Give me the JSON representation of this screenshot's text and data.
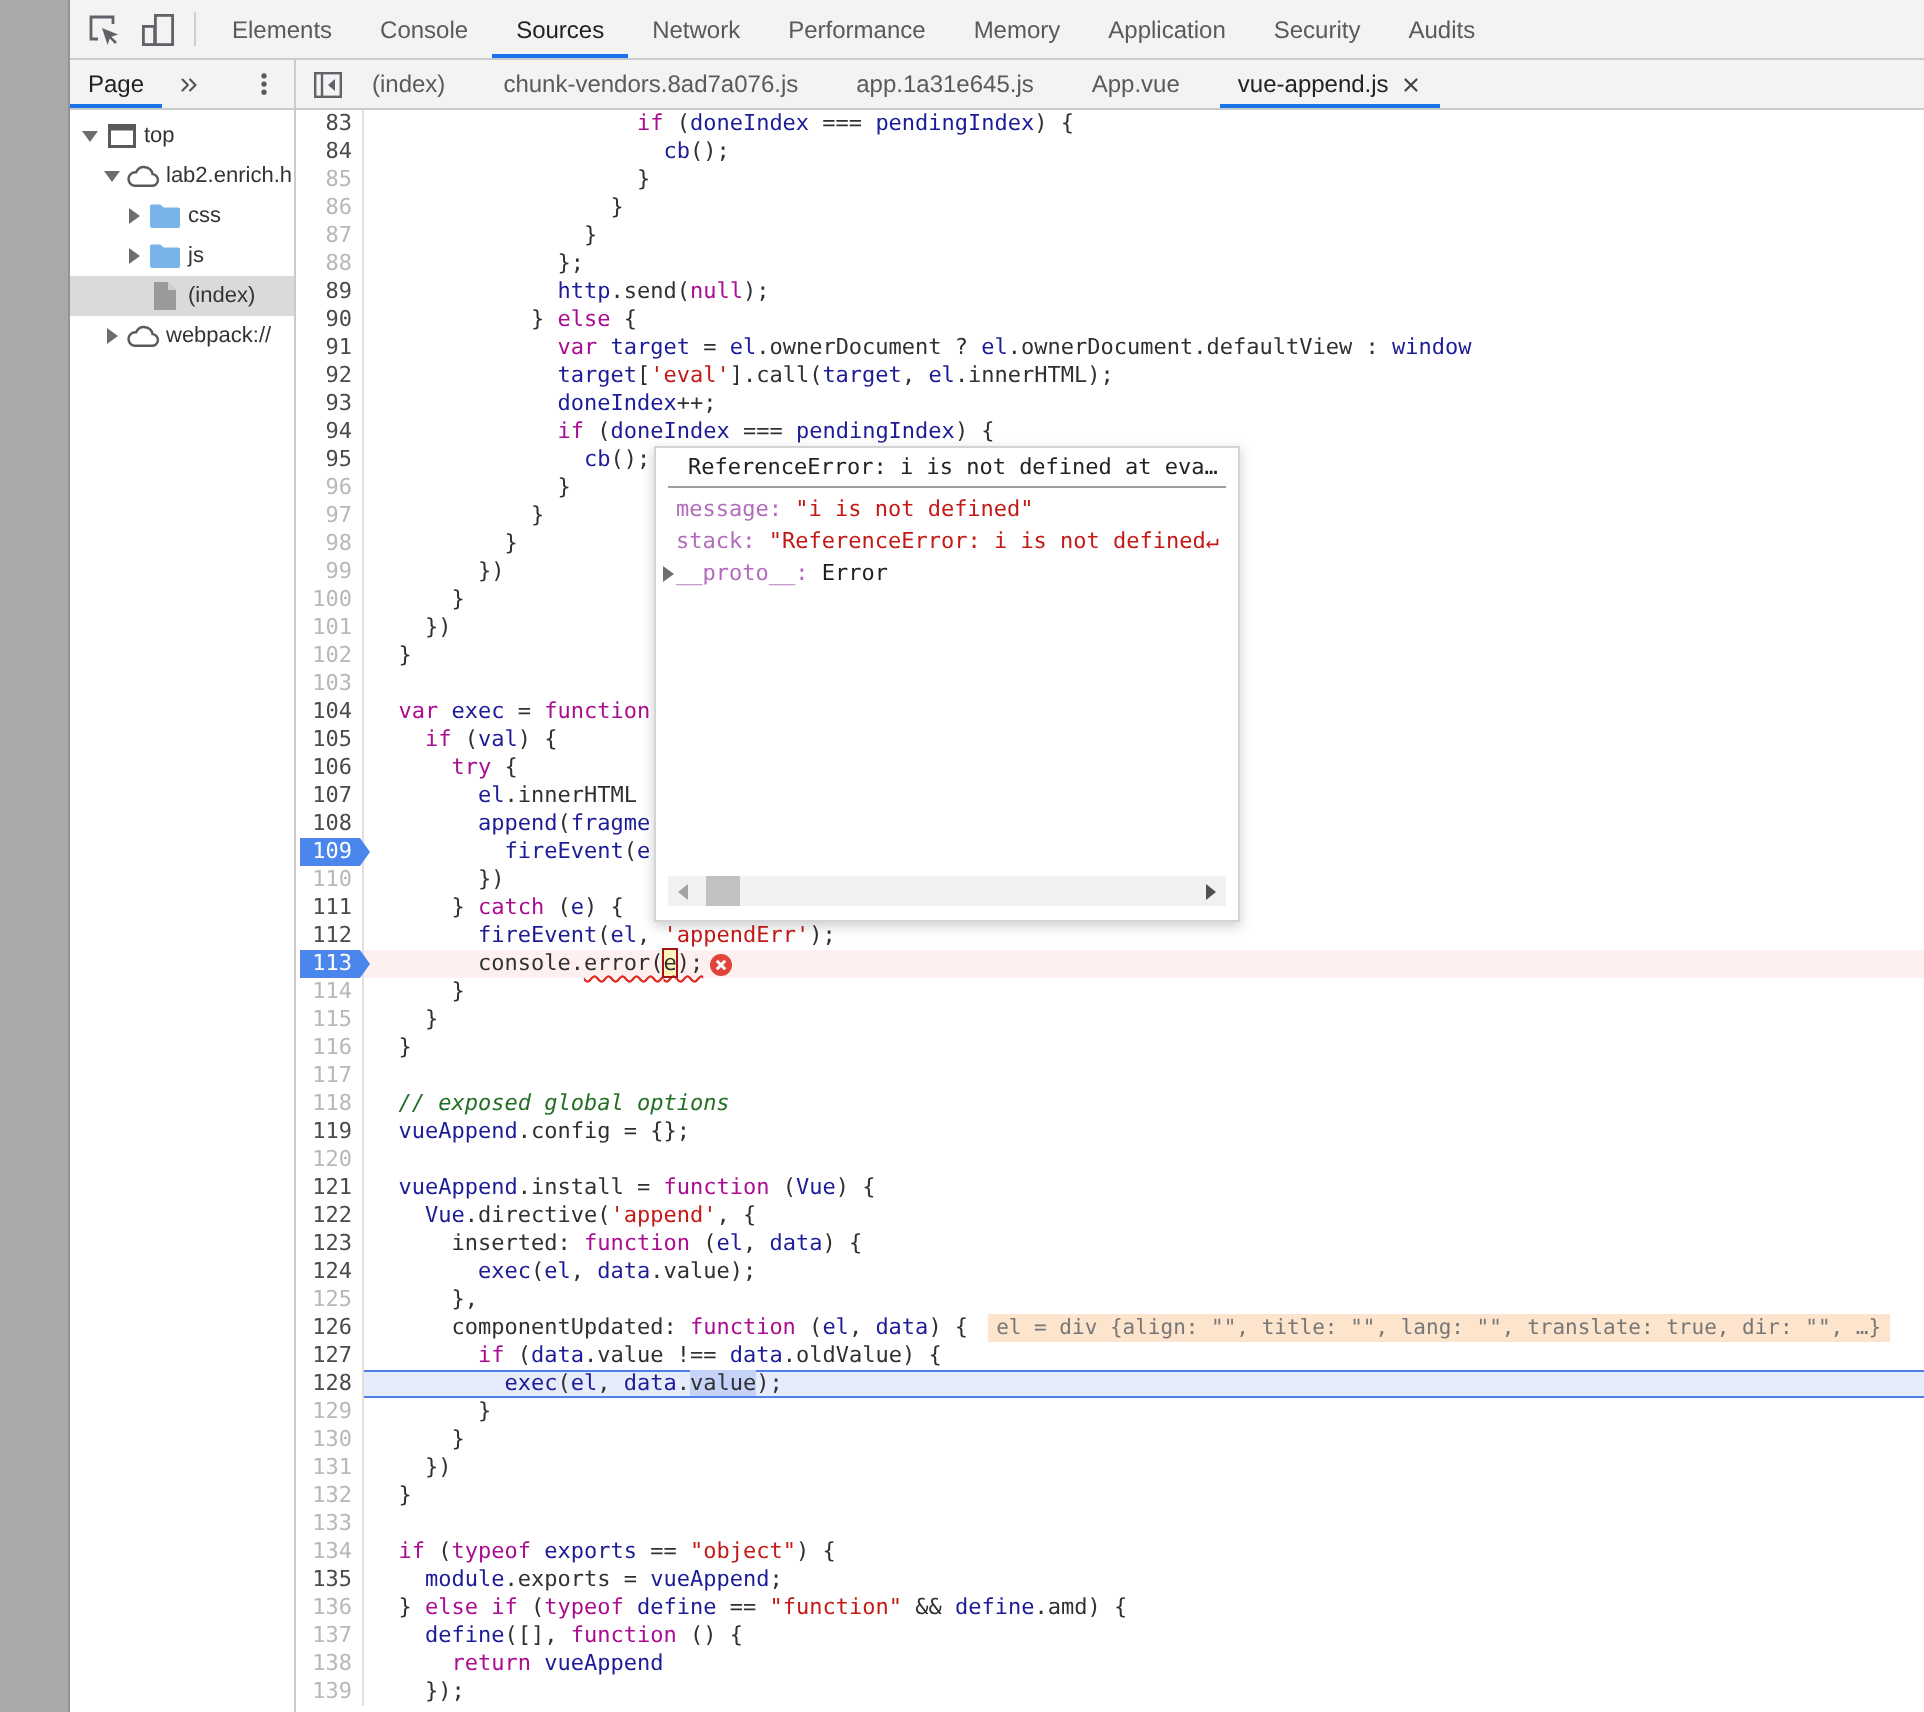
{
  "toolbar": {
    "tabs": [
      {
        "label": "Elements",
        "selected": false
      },
      {
        "label": "Console",
        "selected": false
      },
      {
        "label": "Sources",
        "selected": true
      },
      {
        "label": "Network",
        "selected": false
      },
      {
        "label": "Performance",
        "selected": false
      },
      {
        "label": "Memory",
        "selected": false
      },
      {
        "label": "Application",
        "selected": false
      },
      {
        "label": "Security",
        "selected": false
      },
      {
        "label": "Audits",
        "selected": false
      }
    ]
  },
  "navigator": {
    "tabs": [
      {
        "label": "Page",
        "selected": true
      }
    ],
    "tree": [
      {
        "label": "top",
        "kind": "frame",
        "expanded": true,
        "selected": false,
        "children": [
          {
            "label": "lab2.enrich.h",
            "kind": "domain",
            "expanded": true,
            "selected": false,
            "children": [
              {
                "label": "css",
                "kind": "folder",
                "expanded": false,
                "selected": false
              },
              {
                "label": "js",
                "kind": "folder",
                "expanded": false,
                "selected": false
              },
              {
                "label": "(index)",
                "kind": "file",
                "selected": true
              }
            ]
          },
          {
            "label": "webpack://",
            "kind": "domain",
            "expanded": false,
            "selected": false
          }
        ]
      }
    ]
  },
  "editor": {
    "tabs": [
      {
        "label": "(index)",
        "selected": false,
        "closable": false
      },
      {
        "label": "chunk-vendors.8ad7a076.js",
        "selected": false,
        "closable": false
      },
      {
        "label": "app.1a31e645.js",
        "selected": false,
        "closable": false
      },
      {
        "label": "App.vue",
        "selected": false,
        "closable": false
      },
      {
        "label": "vue-append.js",
        "selected": true,
        "closable": true
      }
    ],
    "lines": [
      {
        "number": "83",
        "executable": true,
        "breakpoint": false,
        "current": false,
        "error": false,
        "tokens": [
          {
            "kind": "keyword",
            "text": "                    if"
          },
          {
            "kind": "plain",
            "text": " ("
          },
          {
            "kind": "variable",
            "text": "doneIndex"
          },
          {
            "kind": "plain",
            "text": " === "
          },
          {
            "kind": "variable",
            "text": "pendingIndex"
          },
          {
            "kind": "plain",
            "text": ") {"
          }
        ]
      },
      {
        "number": "84",
        "executable": true,
        "breakpoint": false,
        "current": false,
        "error": false,
        "tokens": [
          {
            "kind": "variable",
            "text": "                      cb"
          },
          {
            "kind": "plain",
            "text": "();"
          }
        ]
      },
      {
        "number": "85",
        "executable": false,
        "breakpoint": false,
        "current": false,
        "error": false,
        "tokens": [
          {
            "kind": "plain",
            "text": "                    }"
          }
        ]
      },
      {
        "number": "86",
        "executable": false,
        "breakpoint": false,
        "current": false,
        "error": false,
        "tokens": [
          {
            "kind": "plain",
            "text": "                  }"
          }
        ]
      },
      {
        "number": "87",
        "executable": false,
        "breakpoint": false,
        "current": false,
        "error": false,
        "tokens": [
          {
            "kind": "plain",
            "text": "                }"
          }
        ]
      },
      {
        "number": "88",
        "executable": false,
        "breakpoint": false,
        "current": false,
        "error": false,
        "tokens": [
          {
            "kind": "plain",
            "text": "              };"
          }
        ]
      },
      {
        "number": "89",
        "executable": true,
        "breakpoint": false,
        "current": false,
        "error": false,
        "tokens": [
          {
            "kind": "variable",
            "text": "              http"
          },
          {
            "kind": "plain",
            "text": ".send("
          },
          {
            "kind": "keyword",
            "text": "null"
          },
          {
            "kind": "plain",
            "text": ");"
          }
        ]
      },
      {
        "number": "90",
        "executable": true,
        "breakpoint": false,
        "current": false,
        "error": false,
        "tokens": [
          {
            "kind": "plain",
            "text": "            } "
          },
          {
            "kind": "keyword",
            "text": "else"
          },
          {
            "kind": "plain",
            "text": " {"
          }
        ]
      },
      {
        "number": "91",
        "executable": true,
        "breakpoint": false,
        "current": false,
        "error": false,
        "tokens": [
          {
            "kind": "keyword",
            "text": "              var"
          },
          {
            "kind": "variable",
            "text": " target"
          },
          {
            "kind": "plain",
            "text": " = "
          },
          {
            "kind": "variable",
            "text": "el"
          },
          {
            "kind": "plain",
            "text": ".ownerDocument ? "
          },
          {
            "kind": "variable",
            "text": "el"
          },
          {
            "kind": "plain",
            "text": ".ownerDocument.defaultView : "
          },
          {
            "kind": "variable",
            "text": "window"
          }
        ]
      },
      {
        "number": "92",
        "executable": true,
        "breakpoint": false,
        "current": false,
        "error": false,
        "tokens": [
          {
            "kind": "variable",
            "text": "              target"
          },
          {
            "kind": "plain",
            "text": "["
          },
          {
            "kind": "string",
            "text": "'eval'"
          },
          {
            "kind": "plain",
            "text": "].call("
          },
          {
            "kind": "variable",
            "text": "target"
          },
          {
            "kind": "plain",
            "text": ", "
          },
          {
            "kind": "variable",
            "text": "el"
          },
          {
            "kind": "plain",
            "text": ".innerHTML);"
          }
        ]
      },
      {
        "number": "93",
        "executable": true,
        "breakpoint": false,
        "current": false,
        "error": false,
        "tokens": [
          {
            "kind": "variable",
            "text": "              doneIndex"
          },
          {
            "kind": "plain",
            "text": "++;"
          }
        ]
      },
      {
        "number": "94",
        "executable": true,
        "breakpoint": false,
        "current": false,
        "error": false,
        "tokens": [
          {
            "kind": "keyword",
            "text": "              if"
          },
          {
            "kind": "plain",
            "text": " ("
          },
          {
            "kind": "variable",
            "text": "doneIndex"
          },
          {
            "kind": "plain",
            "text": " === "
          },
          {
            "kind": "variable",
            "text": "pendingIndex"
          },
          {
            "kind": "plain",
            "text": ") {"
          }
        ]
      },
      {
        "number": "95",
        "executable": true,
        "breakpoint": false,
        "current": false,
        "error": false,
        "tokens": [
          {
            "kind": "variable",
            "text": "                cb"
          },
          {
            "kind": "plain",
            "text": "();"
          }
        ]
      },
      {
        "number": "96",
        "executable": false,
        "breakpoint": false,
        "current": false,
        "error": false,
        "tokens": [
          {
            "kind": "plain",
            "text": "              }"
          }
        ]
      },
      {
        "number": "97",
        "executable": false,
        "breakpoint": false,
        "current": false,
        "error": false,
        "tokens": [
          {
            "kind": "plain",
            "text": "            }"
          }
        ]
      },
      {
        "number": "98",
        "executable": false,
        "breakpoint": false,
        "current": false,
        "error": false,
        "tokens": [
          {
            "kind": "plain",
            "text": "          }"
          }
        ]
      },
      {
        "number": "99",
        "executable": false,
        "breakpoint": false,
        "current": false,
        "error": false,
        "tokens": [
          {
            "kind": "plain",
            "text": "        })"
          }
        ]
      },
      {
        "number": "100",
        "executable": false,
        "breakpoint": false,
        "current": false,
        "error": false,
        "tokens": [
          {
            "kind": "plain",
            "text": "      }"
          }
        ]
      },
      {
        "number": "101",
        "executable": false,
        "breakpoint": false,
        "current": false,
        "error": false,
        "tokens": [
          {
            "kind": "plain",
            "text": "    })"
          }
        ]
      },
      {
        "number": "102",
        "executable": false,
        "breakpoint": false,
        "current": false,
        "error": false,
        "tokens": [
          {
            "kind": "plain",
            "text": "  }"
          }
        ]
      },
      {
        "number": "103",
        "executable": false,
        "breakpoint": false,
        "current": false,
        "error": false
      },
      {
        "number": "104",
        "executable": true,
        "breakpoint": false,
        "current": false,
        "error": false,
        "tokens": [
          {
            "kind": "keyword",
            "text": "  var"
          },
          {
            "kind": "variable",
            "text": " exec"
          },
          {
            "kind": "plain",
            "text": " = "
          },
          {
            "kind": "keyword",
            "text": "function"
          }
        ]
      },
      {
        "number": "105",
        "executable": true,
        "breakpoint": false,
        "current": false,
        "error": false,
        "tokens": [
          {
            "kind": "keyword",
            "text": "    if"
          },
          {
            "kind": "plain",
            "text": " ("
          },
          {
            "kind": "variable",
            "text": "val"
          },
          {
            "kind": "plain",
            "text": ") {"
          }
        ]
      },
      {
        "number": "106",
        "executable": true,
        "breakpoint": false,
        "current": false,
        "error": false,
        "tokens": [
          {
            "kind": "keyword",
            "text": "      try"
          },
          {
            "kind": "plain",
            "text": " {"
          }
        ]
      },
      {
        "number": "107",
        "executable": true,
        "breakpoint": false,
        "current": false,
        "error": false,
        "tokens": [
          {
            "kind": "variable",
            "text": "        el"
          },
          {
            "kind": "plain",
            "text": ".innerHTML"
          }
        ]
      },
      {
        "number": "108",
        "executable": true,
        "breakpoint": false,
        "current": false,
        "error": false,
        "tokens": [
          {
            "kind": "variable",
            "text": "        append"
          },
          {
            "kind": "plain",
            "text": "("
          },
          {
            "kind": "variable",
            "text": "fragme"
          }
        ]
      },
      {
        "number": "109",
        "executable": true,
        "breakpoint": true,
        "current": false,
        "error": false,
        "tokens": [
          {
            "kind": "variable",
            "text": "          fireEvent"
          },
          {
            "kind": "plain",
            "text": "("
          },
          {
            "kind": "variable",
            "text": "e"
          }
        ]
      },
      {
        "number": "110",
        "executable": false,
        "breakpoint": false,
        "current": false,
        "error": false,
        "tokens": [
          {
            "kind": "plain",
            "text": "        })"
          }
        ]
      },
      {
        "number": "111",
        "executable": true,
        "breakpoint": false,
        "current": false,
        "error": false,
        "tokens": [
          {
            "kind": "plain",
            "text": "      } "
          },
          {
            "kind": "keyword",
            "text": "catch"
          },
          {
            "kind": "plain",
            "text": " ("
          },
          {
            "kind": "variable",
            "text": "e"
          },
          {
            "kind": "plain",
            "text": ") {"
          }
        ]
      },
      {
        "number": "112",
        "executable": true,
        "breakpoint": false,
        "current": false,
        "error": false,
        "tokens": [
          {
            "kind": "variable",
            "text": "        fireEvent"
          },
          {
            "kind": "plain",
            "text": "("
          },
          {
            "kind": "variable",
            "text": "el"
          },
          {
            "kind": "plain",
            "text": ", "
          },
          {
            "kind": "string",
            "text": "'appendErr'"
          },
          {
            "kind": "plain",
            "text": ");"
          }
        ]
      },
      {
        "number": "113",
        "executable": true,
        "breakpoint": true,
        "current": false,
        "error": true,
        "tokens": [
          {
            "kind": "plain",
            "text": "        console."
          },
          {
            "kind": "squiggly",
            "text": "error("
          },
          {
            "kind": "hovered",
            "text": "e"
          },
          {
            "kind": "squiggly",
            "text": ");"
          }
        ]
      },
      {
        "number": "114",
        "executable": false,
        "breakpoint": false,
        "current": false,
        "error": false,
        "tokens": [
          {
            "kind": "plain",
            "text": "      }"
          }
        ]
      },
      {
        "number": "115",
        "executable": false,
        "breakpoint": false,
        "current": false,
        "error": false,
        "tokens": [
          {
            "kind": "plain",
            "text": "    }"
          }
        ]
      },
      {
        "number": "116",
        "executable": false,
        "breakpoint": false,
        "current": false,
        "error": false,
        "tokens": [
          {
            "kind": "plain",
            "text": "  }"
          }
        ]
      },
      {
        "number": "117",
        "executable": false,
        "breakpoint": false,
        "current": false,
        "error": false
      },
      {
        "number": "118",
        "executable": false,
        "breakpoint": false,
        "current": false,
        "error": false,
        "tokens": [
          {
            "kind": "comment",
            "text": "  // exposed global options"
          }
        ]
      },
      {
        "number": "119",
        "executable": true,
        "breakpoint": false,
        "current": false,
        "error": false,
        "tokens": [
          {
            "kind": "variable",
            "text": "  vueAppend"
          },
          {
            "kind": "plain",
            "text": ".config = {};"
          }
        ]
      },
      {
        "number": "120",
        "executable": false,
        "breakpoint": false,
        "current": false,
        "error": false
      },
      {
        "number": "121",
        "executable": true,
        "breakpoint": false,
        "current": false,
        "error": false,
        "tokens": [
          {
            "kind": "variable",
            "text": "  vueAppend"
          },
          {
            "kind": "plain",
            "text": ".install = "
          },
          {
            "kind": "keyword",
            "text": "function"
          },
          {
            "kind": "plain",
            "text": " ("
          },
          {
            "kind": "variable",
            "text": "Vue"
          },
          {
            "kind": "plain",
            "text": ") {"
          }
        ]
      },
      {
        "number": "122",
        "executable": true,
        "breakpoint": false,
        "current": false,
        "error": false,
        "tokens": [
          {
            "kind": "variable",
            "text": "    Vue"
          },
          {
            "kind": "plain",
            "text": ".directive("
          },
          {
            "kind": "string",
            "text": "'append'"
          },
          {
            "kind": "plain",
            "text": ", {"
          }
        ]
      },
      {
        "number": "123",
        "executable": true,
        "breakpoint": false,
        "current": false,
        "error": false,
        "tokens": [
          {
            "kind": "plain",
            "text": "      inserted: "
          },
          {
            "kind": "keyword",
            "text": "function"
          },
          {
            "kind": "plain",
            "text": " ("
          },
          {
            "kind": "variable",
            "text": "el"
          },
          {
            "kind": "plain",
            "text": ", "
          },
          {
            "kind": "variable",
            "text": "data"
          },
          {
            "kind": "plain",
            "text": ") {"
          }
        ]
      },
      {
        "number": "124",
        "executable": true,
        "breakpoint": false,
        "current": false,
        "error": false,
        "tokens": [
          {
            "kind": "variable",
            "text": "        exec"
          },
          {
            "kind": "plain",
            "text": "("
          },
          {
            "kind": "variable",
            "text": "el"
          },
          {
            "kind": "plain",
            "text": ", "
          },
          {
            "kind": "variable",
            "text": "data"
          },
          {
            "kind": "plain",
            "text": ".value);"
          }
        ]
      },
      {
        "number": "125",
        "executable": false,
        "breakpoint": false,
        "current": false,
        "error": false,
        "tokens": [
          {
            "kind": "plain",
            "text": "      },"
          }
        ]
      },
      {
        "number": "126",
        "executable": true,
        "breakpoint": false,
        "current": false,
        "error": false,
        "tokens": [
          {
            "kind": "plain",
            "text": "      componentUpdated: "
          },
          {
            "kind": "keyword",
            "text": "function"
          },
          {
            "kind": "plain",
            "text": " ("
          },
          {
            "kind": "variable",
            "text": "el"
          },
          {
            "kind": "plain",
            "text": ", "
          },
          {
            "kind": "variable",
            "text": "data"
          },
          {
            "kind": "plain",
            "text": ") {"
          }
        ],
        "inline_value": "el = div {align: \"\", title: \"\", lang: \"\", translate: true, dir: \"\", …}"
      },
      {
        "number": "127",
        "executable": true,
        "breakpoint": false,
        "current": false,
        "error": false,
        "tokens": [
          {
            "kind": "keyword",
            "text": "        if"
          },
          {
            "kind": "plain",
            "text": " ("
          },
          {
            "kind": "variable",
            "text": "data"
          },
          {
            "kind": "plain",
            "text": ".value !== "
          },
          {
            "kind": "variable",
            "text": "data"
          },
          {
            "kind": "plain",
            "text": ".oldValue) {"
          }
        ]
      },
      {
        "number": "128",
        "executable": true,
        "breakpoint": false,
        "current": true,
        "error": false,
        "tokens": [
          {
            "kind": "variable",
            "text": "          exec"
          },
          {
            "kind": "plain",
            "text": "("
          },
          {
            "kind": "variable",
            "text": "el"
          },
          {
            "kind": "plain",
            "text": ", "
          },
          {
            "kind": "variable",
            "text": "data"
          },
          {
            "kind": "plain",
            "text": "."
          },
          {
            "kind": "selection",
            "text": "value"
          },
          {
            "kind": "plain",
            "text": ");"
          }
        ]
      },
      {
        "number": "129",
        "executable": false,
        "breakpoint": false,
        "current": false,
        "error": false,
        "tokens": [
          {
            "kind": "plain",
            "text": "        }"
          }
        ]
      },
      {
        "number": "130",
        "executable": false,
        "breakpoint": false,
        "current": false,
        "error": false,
        "tokens": [
          {
            "kind": "plain",
            "text": "      }"
          }
        ]
      },
      {
        "number": "131",
        "executable": false,
        "breakpoint": false,
        "current": false,
        "error": false,
        "tokens": [
          {
            "kind": "plain",
            "text": "    })"
          }
        ]
      },
      {
        "number": "132",
        "executable": false,
        "breakpoint": false,
        "current": false,
        "error": false,
        "tokens": [
          {
            "kind": "plain",
            "text": "  }"
          }
        ]
      },
      {
        "number": "133",
        "executable": false,
        "breakpoint": false,
        "current": false,
        "error": false
      },
      {
        "number": "134",
        "executable": false,
        "breakpoint": false,
        "current": false,
        "error": false,
        "tokens": [
          {
            "kind": "keyword",
            "text": "  if"
          },
          {
            "kind": "plain",
            "text": " ("
          },
          {
            "kind": "keyword",
            "text": "typeof"
          },
          {
            "kind": "variable",
            "text": " exports"
          },
          {
            "kind": "plain",
            "text": " == "
          },
          {
            "kind": "string",
            "text": "\"object\""
          },
          {
            "kind": "plain",
            "text": ") {"
          }
        ]
      },
      {
        "number": "135",
        "executable": true,
        "breakpoint": false,
        "current": false,
        "error": false,
        "tokens": [
          {
            "kind": "variable",
            "text": "    module"
          },
          {
            "kind": "plain",
            "text": ".exports = "
          },
          {
            "kind": "variable",
            "text": "vueAppend"
          },
          {
            "kind": "plain",
            "text": ";"
          }
        ]
      },
      {
        "number": "136",
        "executable": false,
        "breakpoint": false,
        "current": false,
        "error": false,
        "tokens": [
          {
            "kind": "plain",
            "text": "  } "
          },
          {
            "kind": "keyword",
            "text": "else"
          },
          {
            "kind": "keyword",
            "text": " if"
          },
          {
            "kind": "plain",
            "text": " ("
          },
          {
            "kind": "keyword",
            "text": "typeof"
          },
          {
            "kind": "variable",
            "text": " define"
          },
          {
            "kind": "plain",
            "text": " == "
          },
          {
            "kind": "string",
            "text": "\"function\""
          },
          {
            "kind": "plain",
            "text": " && "
          },
          {
            "kind": "variable",
            "text": "define"
          },
          {
            "kind": "plain",
            "text": ".amd) {"
          }
        ]
      },
      {
        "number": "137",
        "executable": false,
        "breakpoint": false,
        "current": false,
        "error": false,
        "tokens": [
          {
            "kind": "variable",
            "text": "    define"
          },
          {
            "kind": "plain",
            "text": "([], "
          },
          {
            "kind": "keyword",
            "text": "function"
          },
          {
            "kind": "plain",
            "text": " () {"
          }
        ]
      },
      {
        "number": "138",
        "executable": false,
        "breakpoint": false,
        "current": false,
        "error": false,
        "tokens": [
          {
            "kind": "keyword",
            "text": "      return"
          },
          {
            "kind": "variable",
            "text": " vueAppend"
          }
        ]
      },
      {
        "number": "139",
        "executable": false,
        "breakpoint": false,
        "current": false,
        "error": false,
        "tokens": [
          {
            "kind": "plain",
            "text": "    });"
          }
        ]
      }
    ],
    "popover": {
      "title": "ReferenceError: i is not defined at eva…",
      "properties": [
        {
          "name": "message:",
          "value": "\"i is not defined\"",
          "kind": "string"
        },
        {
          "name": "stack:",
          "value": "\"ReferenceError: i is not defined↵",
          "kind": "string"
        },
        {
          "name": "__proto__:",
          "value": "Error",
          "kind": "object",
          "expanded": false
        }
      ]
    }
  }
}
